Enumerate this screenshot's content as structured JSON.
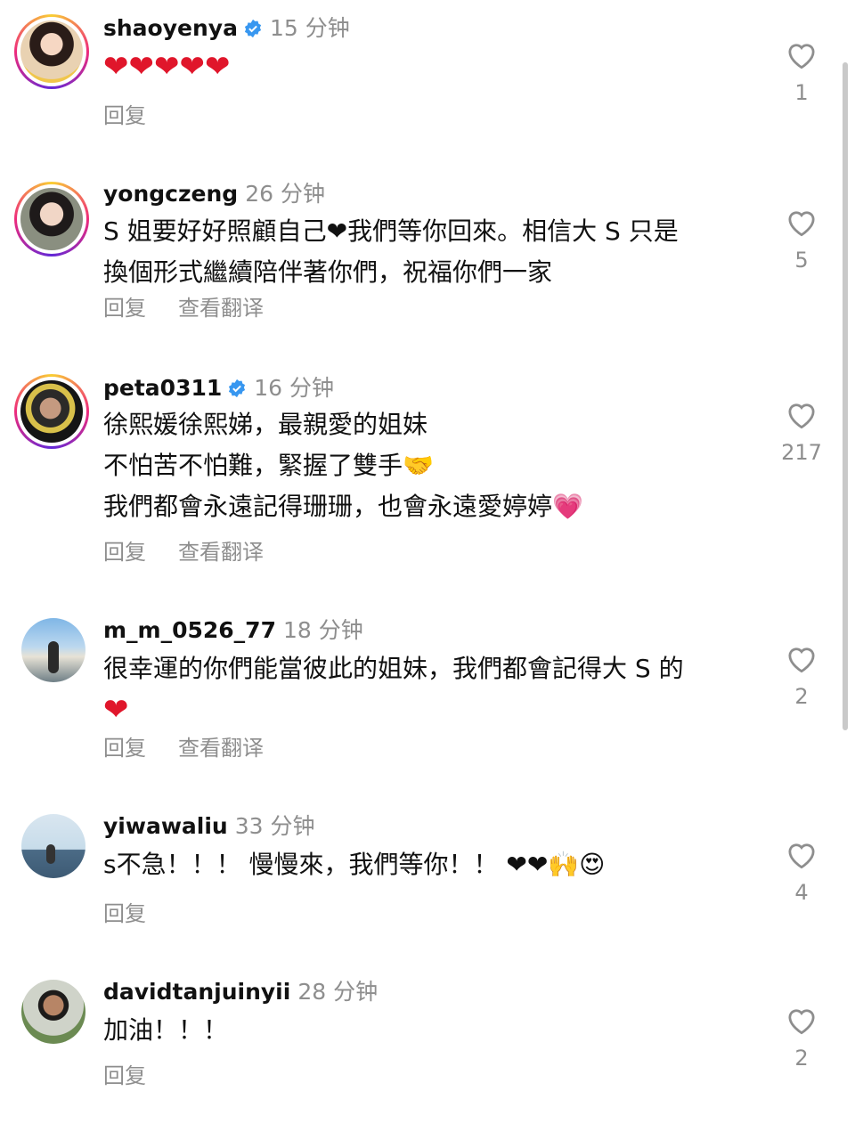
{
  "comments": [
    {
      "user": "shaoyenya",
      "verified": true,
      "time": "15 分钟",
      "lines": [
        "❤❤❤❤❤"
      ],
      "reply": "回复",
      "translate": "",
      "likes": "1"
    },
    {
      "user": "yongczeng",
      "verified": false,
      "time": "26 分钟",
      "lines": [
        "S 姐要好好照顧自己❤我們等你回來。相信大 S 只是",
        "換個形式繼續陪伴著你們，祝福你們一家"
      ],
      "reply": "回复",
      "translate": "查看翻译",
      "likes": "5"
    },
    {
      "user": "peta0311",
      "verified": true,
      "time": "16 分钟",
      "lines": [
        "徐熙媛徐熙娣，最親愛的姐妹",
        "不怕苦不怕難，緊握了雙手🤝",
        "我們都會永遠記得珊珊，也會永遠愛婷婷💗"
      ],
      "reply": "回复",
      "translate": "查看翻译",
      "likes": "217"
    },
    {
      "user": "m_m_0526_77",
      "verified": false,
      "time": "18 分钟",
      "lines": [
        "很幸運的你們能當彼此的姐妹，我們都會記得大 S 的",
        "❤"
      ],
      "reply": "回复",
      "translate": "查看翻译",
      "likes": "2"
    },
    {
      "user": "yiwawaliu",
      "verified": false,
      "time": "33 分钟",
      "lines": [
        "s不急！！！ 慢慢來，我們等你！！ ❤❤🙌😍"
      ],
      "reply": "回复",
      "translate": "",
      "likes": "4"
    },
    {
      "user": "davidtanjuinyii",
      "verified": false,
      "time": "28 分钟",
      "lines": [
        "加油！！！"
      ],
      "reply": "回复",
      "translate": "",
      "likes": "2"
    }
  ],
  "colors": {
    "accent_verified": "#3897f0",
    "muted": "#8e8e8e",
    "heart_red": "#e0162b"
  },
  "icons": {
    "like": "heart-outline-icon",
    "verified": "verified-badge-icon"
  }
}
